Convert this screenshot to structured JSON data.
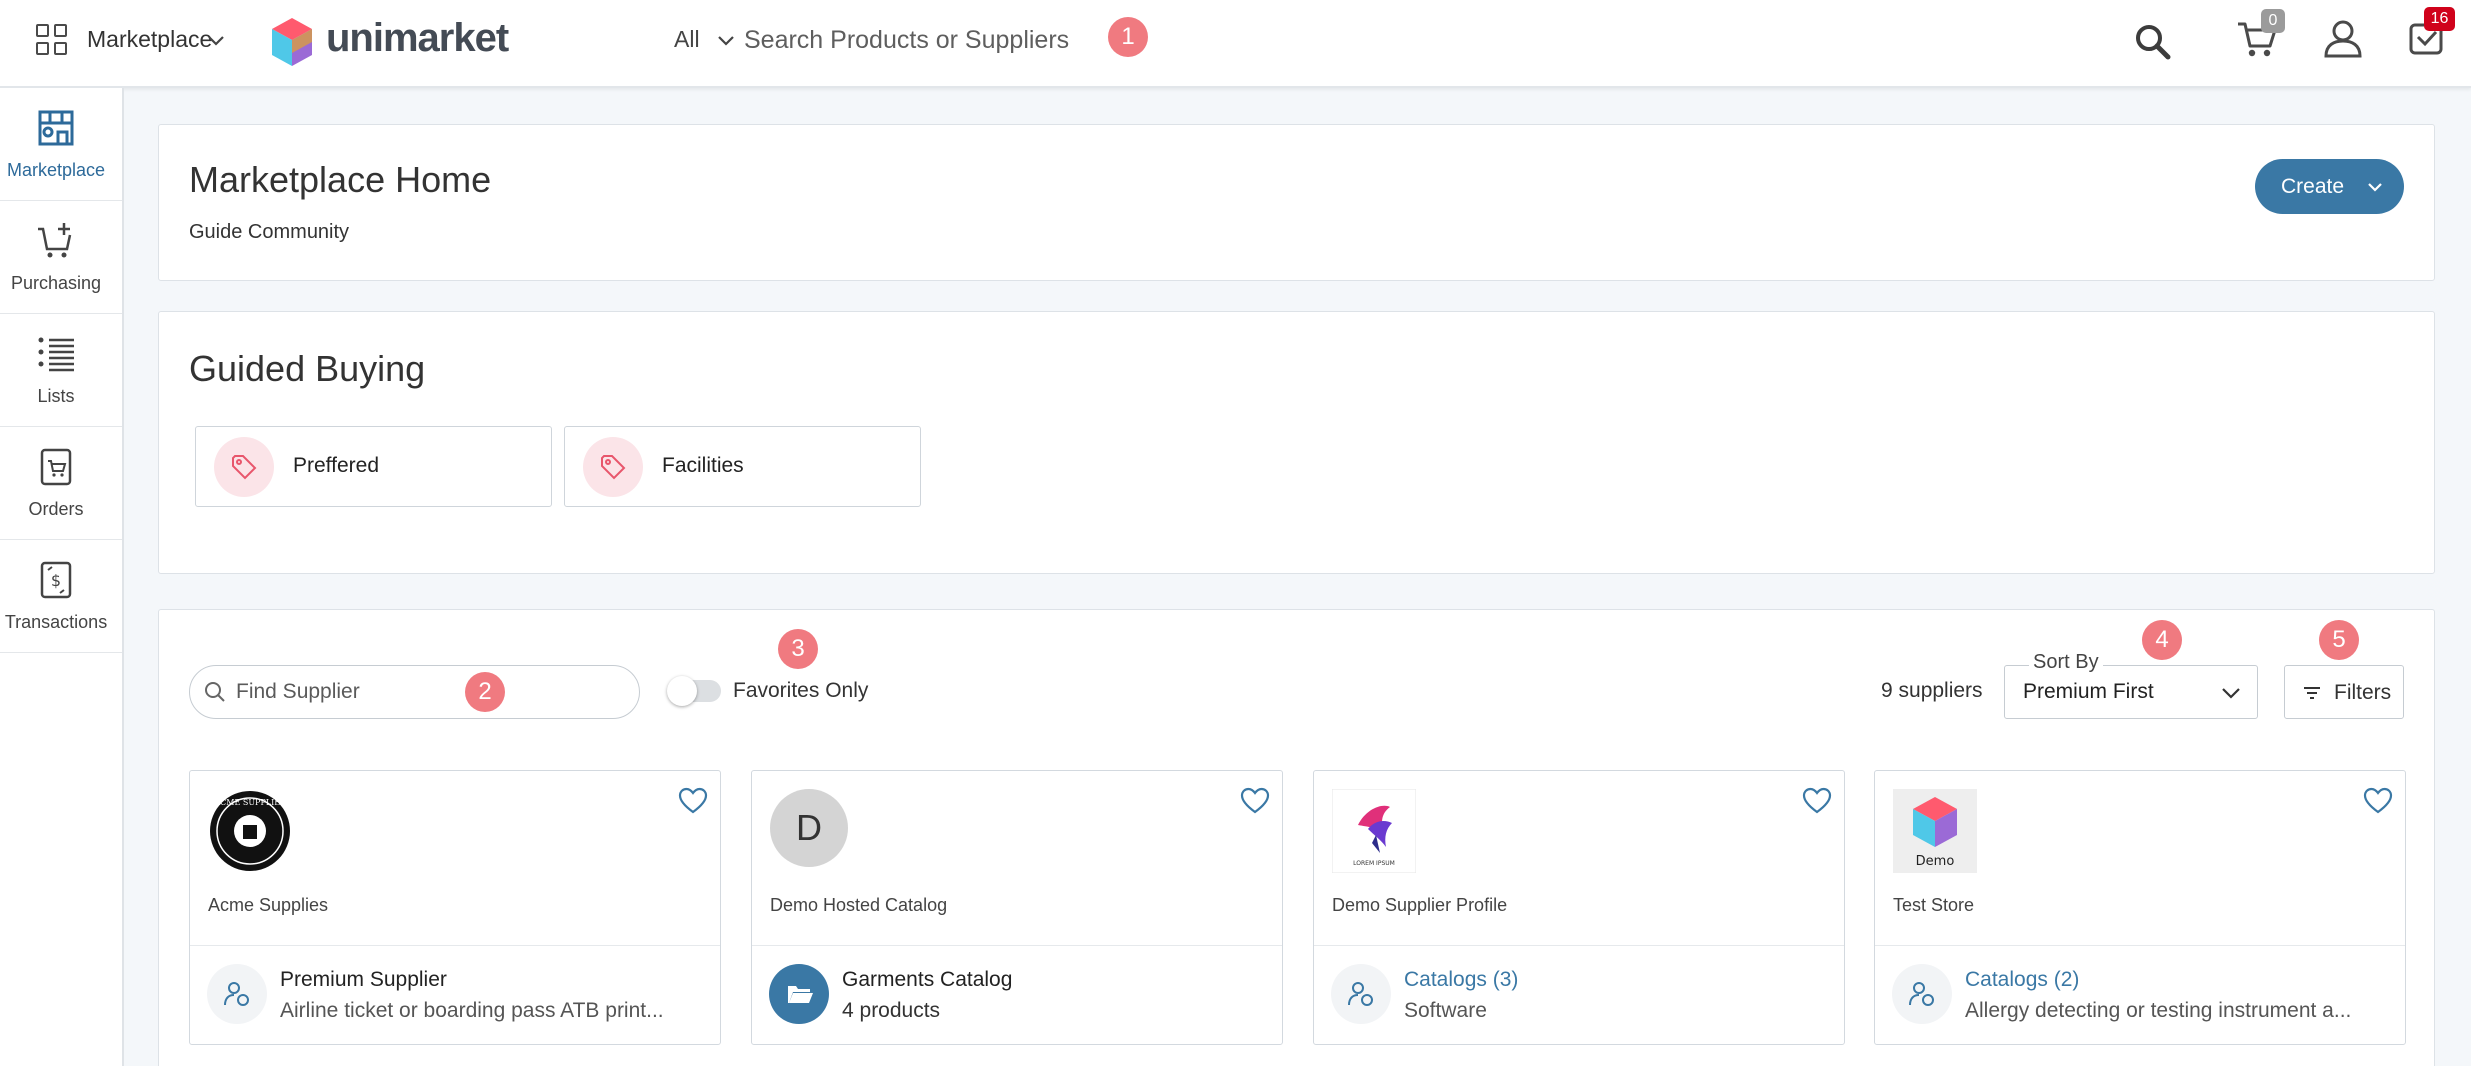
{
  "topbar": {
    "app_switcher_label": "Marketplace",
    "brand_name": "unimarket",
    "search_scope": "All",
    "search_placeholder": "Search Products or Suppliers",
    "cart_count": "0",
    "notifications_count": "16"
  },
  "markers": [
    "1",
    "2",
    "3",
    "4",
    "5"
  ],
  "sidebar": {
    "items": [
      {
        "label": "Marketplace",
        "icon": "storefront-icon",
        "active": true
      },
      {
        "label": "Purchasing",
        "icon": "cart-plus-icon"
      },
      {
        "label": "Lists",
        "icon": "list-icon"
      },
      {
        "label": "Orders",
        "icon": "orders-icon"
      },
      {
        "label": "Transactions",
        "icon": "transactions-icon"
      }
    ]
  },
  "header": {
    "title": "Marketplace Home",
    "subtitle": "Guide Community",
    "create_label": "Create"
  },
  "guided_buying": {
    "title": "Guided Buying",
    "chips": [
      {
        "label": "Preffered",
        "icon": "tag-icon"
      },
      {
        "label": "Facilities",
        "icon": "tag-icon"
      }
    ]
  },
  "suppliers": {
    "find_placeholder": "Find Supplier",
    "favorites_label": "Favorites Only",
    "count_text": "9 suppliers",
    "sort_legend": "Sort By",
    "sort_value": "Premium First",
    "filters_label": "Filters",
    "cards": [
      {
        "name": "Acme Supplies",
        "line1": "Premium Supplier",
        "line2": "Airline ticket or boarding pass ATB print...",
        "logo_text": "ACME SUPPLIES"
      },
      {
        "name": "Demo Hosted Catalog",
        "line1": "Garments Catalog",
        "line2": "4 products",
        "logo_text": "D"
      },
      {
        "name": "Demo Supplier Profile",
        "line1": "Catalogs (3)",
        "line2": "Software",
        "logo_text": "LOREM IPSUM"
      },
      {
        "name": "Test Store",
        "line1": "Catalogs (2)",
        "line2": "Allergy detecting or testing instrument a...",
        "logo_text": "Demo"
      }
    ]
  },
  "colors": {
    "accent": "#3a78a5",
    "marker": "#f07a80",
    "badge_red": "#d0021b",
    "badge_gray": "#9b9b9b",
    "tag_bg": "#fbe4e8"
  }
}
